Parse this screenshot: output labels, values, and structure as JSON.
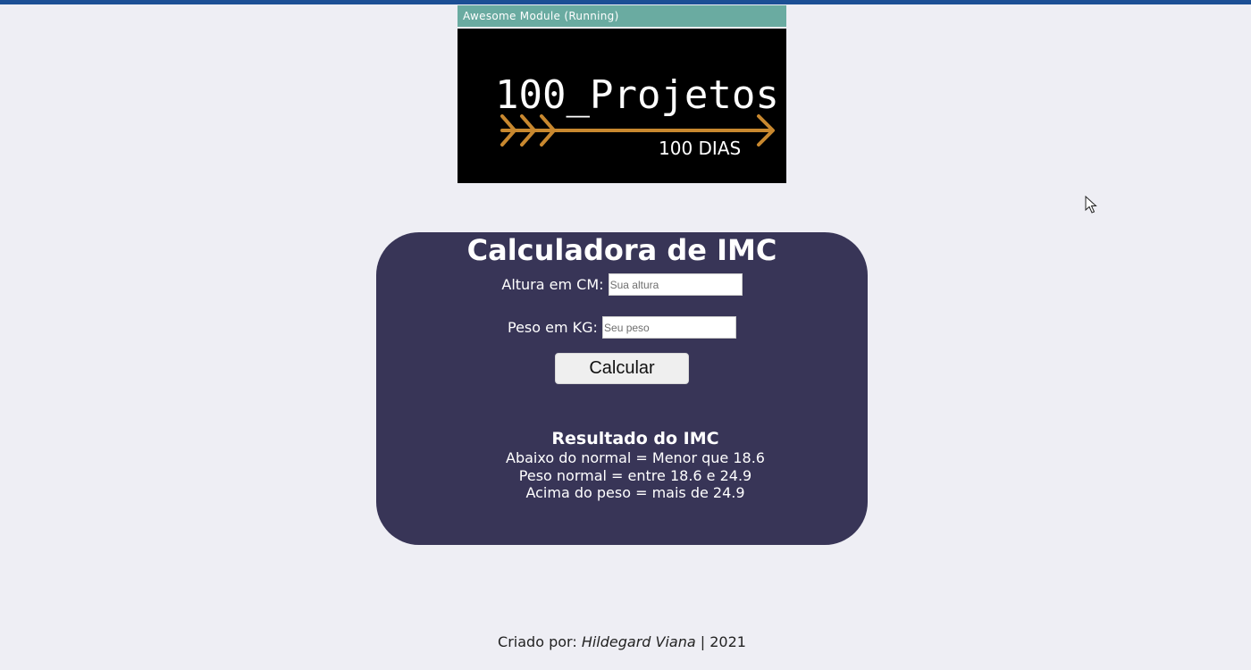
{
  "module_bar": {
    "label": "Awesome Module (Running)"
  },
  "logo": {
    "title": "100_Projetos",
    "subtitle": "100 DIAS"
  },
  "calculator": {
    "title": "Calculadora de IMC",
    "height_label": "Altura em CM:",
    "height_placeholder": "Sua altura",
    "height_value": "",
    "weight_label": "Peso em KG:",
    "weight_placeholder": "Seu peso",
    "weight_value": "",
    "button_label": "Calcular"
  },
  "result": {
    "title": "Resultado do IMC",
    "lines": [
      "Abaixo do normal = Menor que 18.6",
      "Peso normal = entre 18.6 e 24.9",
      "Acima do peso = mais de 24.9"
    ]
  },
  "footer": {
    "prefix": "Criado por:",
    "author": "Hildegard Viana",
    "separator": "|",
    "year": "2021"
  },
  "colors": {
    "page_background": "#eeeef4",
    "top_bar": "#1c4f95",
    "module_bar": "#6aaba1",
    "card": "#383557",
    "logo_arrow": "#c8882f"
  },
  "icons": {
    "cursor": "mouse-pointer-icon",
    "logo_arrow": "arrow-right-icon"
  }
}
